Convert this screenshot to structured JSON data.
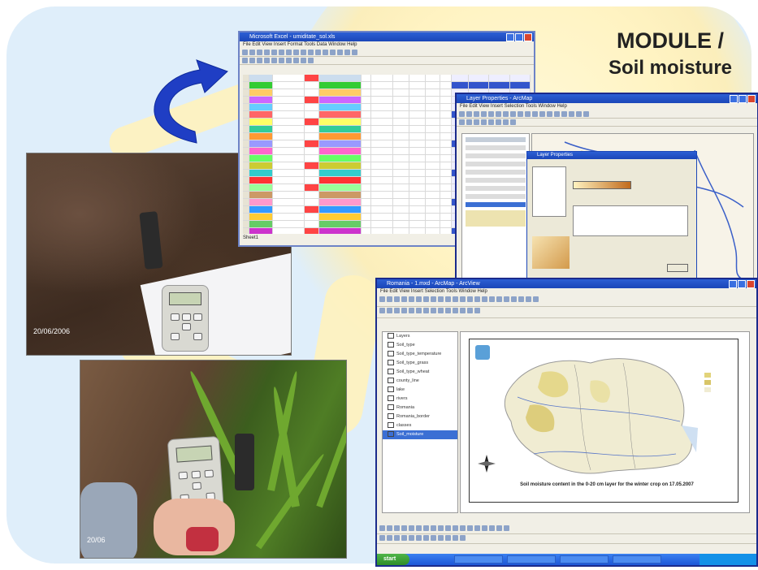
{
  "slide": {
    "title_line1": "MODULE /",
    "title_line2": "Soil moisture"
  },
  "colors": {
    "background": "#dfeefa",
    "sun_glow": "#fff3c2",
    "arrow": "#1f3ec4",
    "window_border": "#1b2b8c",
    "titlebar": "#1b46b8"
  },
  "photos": {
    "top_date": "20/06/2006",
    "bottom_date": "20/06"
  },
  "excel_window": {
    "title": "Microsoft Excel - umiditate_sol.xls",
    "menu": "File  Edit  View  Insert  Format  Tools  Data  Window  Help",
    "sheet_tab": "Sheet1"
  },
  "arcmap_window_1": {
    "title": "Layer Properties - ArcMap",
    "menu": "File  Edit  View  Insert  Selection  Tools  Window  Help",
    "dialog_title": "Layer Properties"
  },
  "arcmap_window_2": {
    "title": "Romania - 1.mxd - ArcMap - ArcView",
    "menu": "File  Edit  View  Insert  Selection  Tools  Window  Help",
    "start_label": "start",
    "map_caption": "Soil moisture content in the 0-20 cm layer for the winter crop on 17.05.2007",
    "toc_layers": [
      "Layers",
      "Soil_type",
      "Soil_type_temperature",
      "Soil_type_grass",
      "Soil_type_wheat",
      "county_line",
      "lake",
      "rivers",
      "Romania",
      "Romania_border",
      "classes",
      "Soil_moisture"
    ]
  }
}
